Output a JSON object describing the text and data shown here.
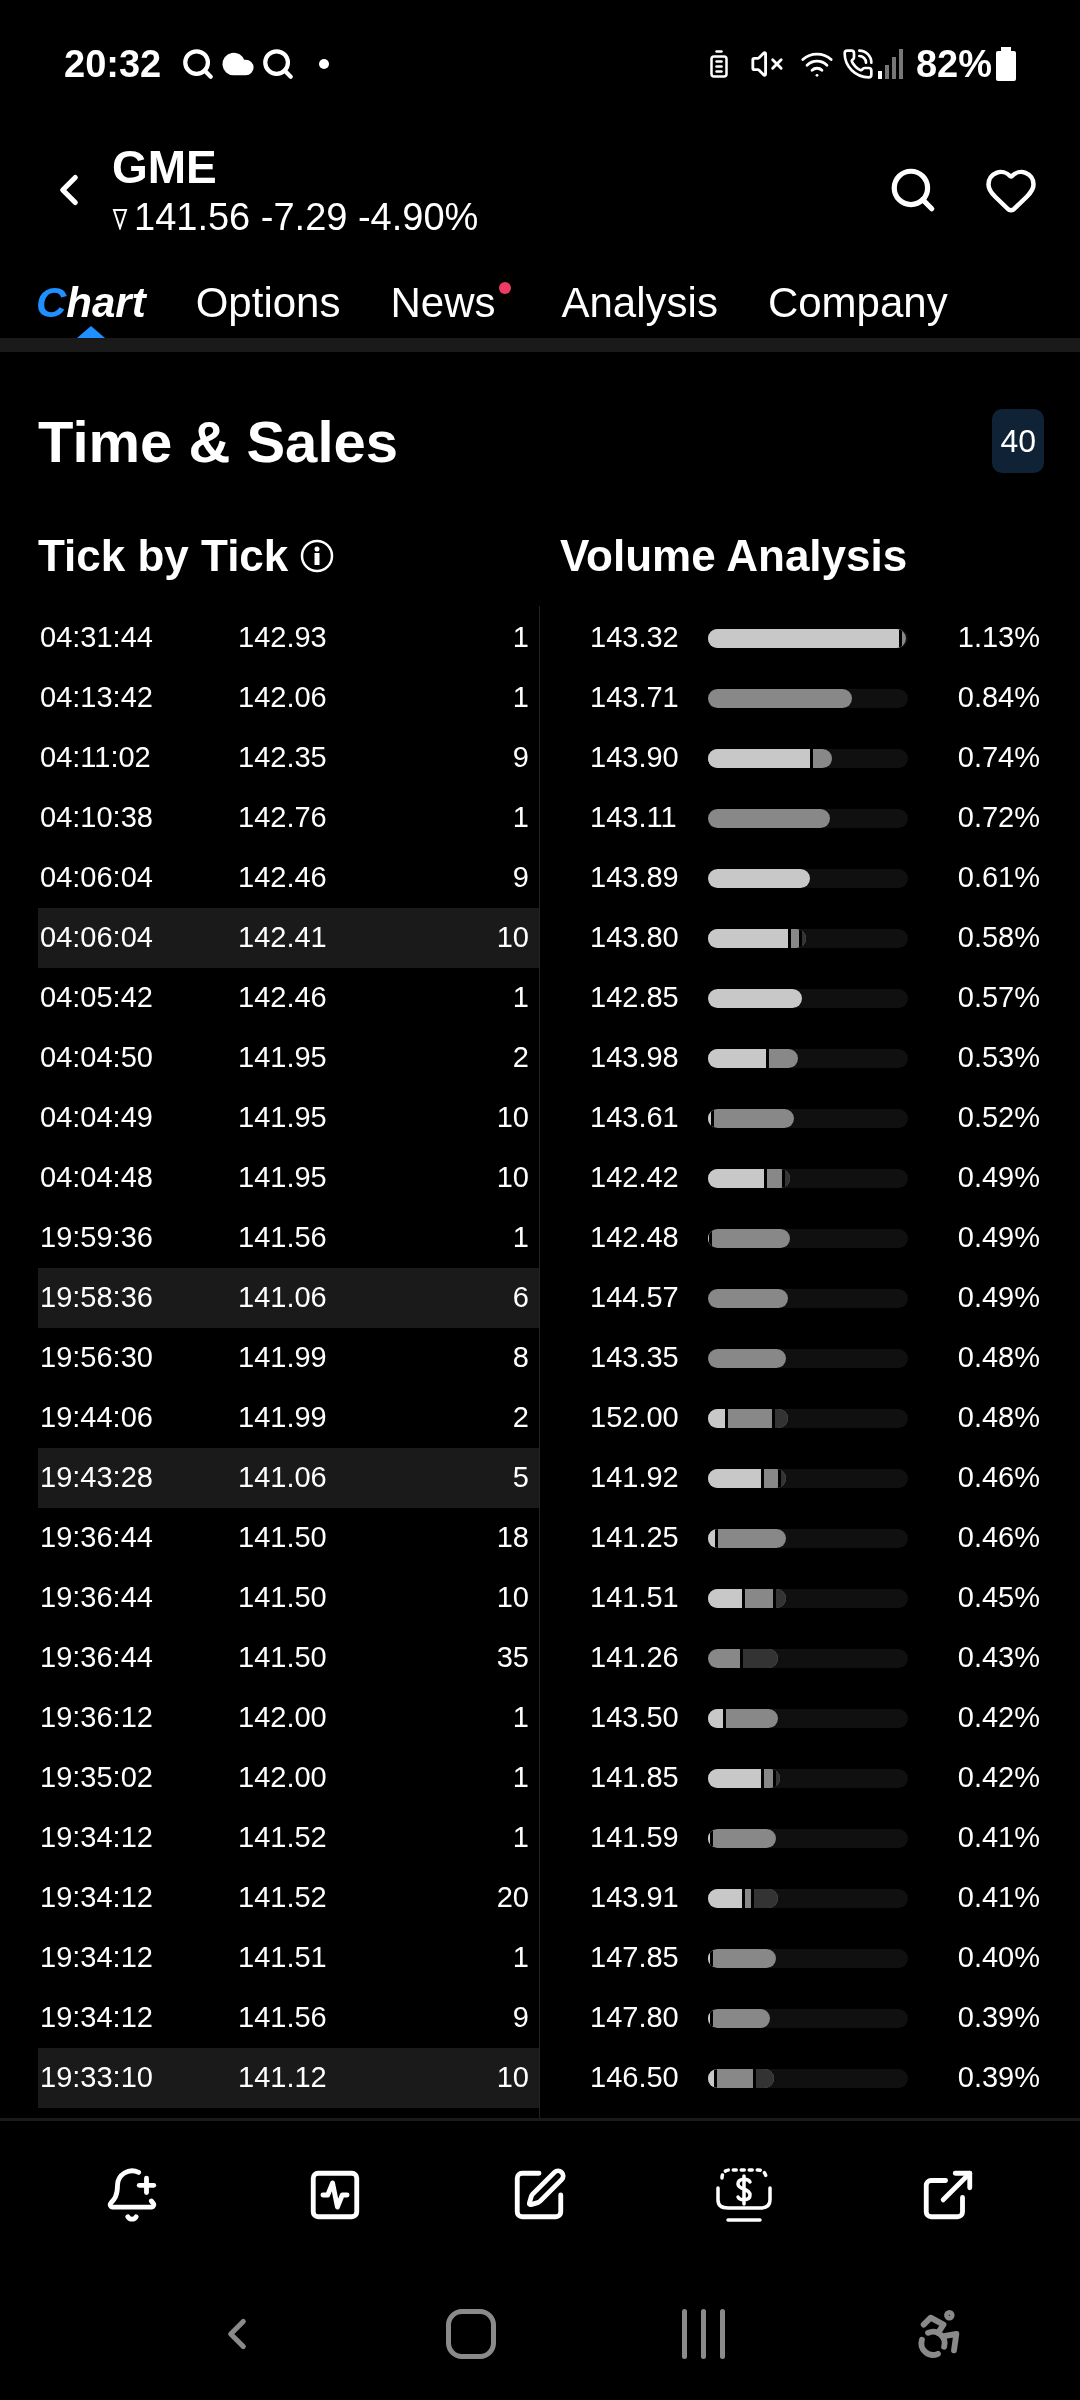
{
  "status_bar": {
    "time": "20:32",
    "battery": "82%"
  },
  "header": {
    "symbol": "GME",
    "quote": "141.56 -7.29 -4.90%",
    "favorite": false
  },
  "tabs": [
    {
      "label": "Chart",
      "selected": true,
      "badge": false
    },
    {
      "label": "Options",
      "selected": false,
      "badge": false
    },
    {
      "label": "News",
      "selected": false,
      "badge": true
    },
    {
      "label": "Analysis",
      "selected": false,
      "badge": false
    },
    {
      "label": "Company",
      "selected": false,
      "badge": false
    }
  ],
  "section": {
    "title": "Time & Sales",
    "count": "40"
  },
  "tick_by_tick": {
    "title": "Tick by Tick",
    "rows": [
      {
        "time": "04:31:44",
        "price": "142.93",
        "size": "1",
        "highlighted": false
      },
      {
        "time": "04:13:42",
        "price": "142.06",
        "size": "1",
        "highlighted": false
      },
      {
        "time": "04:11:02",
        "price": "142.35",
        "size": "9",
        "highlighted": false
      },
      {
        "time": "04:10:38",
        "price": "142.76",
        "size": "1",
        "highlighted": false
      },
      {
        "time": "04:06:04",
        "price": "142.46",
        "size": "9",
        "highlighted": false
      },
      {
        "time": "04:06:04",
        "price": "142.41",
        "size": "10",
        "highlighted": true
      },
      {
        "time": "04:05:42",
        "price": "142.46",
        "size": "1",
        "highlighted": false
      },
      {
        "time": "04:04:50",
        "price": "141.95",
        "size": "2",
        "highlighted": false
      },
      {
        "time": "04:04:49",
        "price": "141.95",
        "size": "10",
        "highlighted": false
      },
      {
        "time": "04:04:48",
        "price": "141.95",
        "size": "10",
        "highlighted": false
      },
      {
        "time": "19:59:36",
        "price": "141.56",
        "size": "1",
        "highlighted": false
      },
      {
        "time": "19:58:36",
        "price": "141.06",
        "size": "6",
        "highlighted": true
      },
      {
        "time": "19:56:30",
        "price": "141.99",
        "size": "8",
        "highlighted": false
      },
      {
        "time": "19:44:06",
        "price": "141.99",
        "size": "2",
        "highlighted": false
      },
      {
        "time": "19:43:28",
        "price": "141.06",
        "size": "5",
        "highlighted": true
      },
      {
        "time": "19:36:44",
        "price": "141.50",
        "size": "18",
        "highlighted": false
      },
      {
        "time": "19:36:44",
        "price": "141.50",
        "size": "10",
        "highlighted": false
      },
      {
        "time": "19:36:44",
        "price": "141.50",
        "size": "35",
        "highlighted": false
      },
      {
        "time": "19:36:12",
        "price": "142.00",
        "size": "1",
        "highlighted": false
      },
      {
        "time": "19:35:02",
        "price": "142.00",
        "size": "1",
        "highlighted": false
      },
      {
        "time": "19:34:12",
        "price": "141.52",
        "size": "1",
        "highlighted": false
      },
      {
        "time": "19:34:12",
        "price": "141.52",
        "size": "20",
        "highlighted": false
      },
      {
        "time": "19:34:12",
        "price": "141.51",
        "size": "1",
        "highlighted": false
      },
      {
        "time": "19:34:12",
        "price": "141.56",
        "size": "9",
        "highlighted": false
      },
      {
        "time": "19:33:10",
        "price": "141.12",
        "size": "10",
        "highlighted": true
      }
    ]
  },
  "volume_analysis": {
    "title": "Volume Analysis",
    "rows": [
      {
        "price": "143.32",
        "share": "1.13%",
        "kind": "mixed",
        "level": 0.99,
        "buy": {
          "level": 0.98
        }
      },
      {
        "price": "143.71",
        "share": "0.84%",
        "kind": "mixed",
        "level": 0.72
      },
      {
        "price": "143.90",
        "share": "0.74%",
        "kind": "mixed",
        "level": 0.62,
        "buy": {
          "level": 0.85
        }
      },
      {
        "price": "143.11",
        "share": "0.72%",
        "kind": "mixed",
        "level": 0.61
      },
      {
        "price": "143.89",
        "share": "0.61%",
        "kind": "buy",
        "level": 0.51
      },
      {
        "price": "143.80",
        "share": "0.58%",
        "kind": "mixed",
        "level": 0.49,
        "buy": {
          "level": 0.85
        },
        "sell": {
          "level": 0.07
        }
      },
      {
        "price": "142.85",
        "share": "0.57%",
        "kind": "buy",
        "level": 0.47
      },
      {
        "price": "143.98",
        "share": "0.53%",
        "kind": "mixed",
        "level": 0.45,
        "buy": {
          "level": 0.68
        }
      },
      {
        "price": "143.61",
        "share": "0.52%",
        "kind": "mixed",
        "level": 0.43,
        "buy": {
          "level": 0.07
        }
      },
      {
        "price": "142.42",
        "share": "0.49%",
        "kind": "mixed",
        "level": 0.41,
        "buy": {
          "level": 0.72
        },
        "sell": {
          "level": 0.1
        }
      },
      {
        "price": "142.48",
        "share": "0.49%",
        "kind": "mixed",
        "level": 0.41,
        "buy": {
          "level": 0.05
        }
      },
      {
        "price": "144.57",
        "share": "0.49%",
        "kind": "mixed",
        "level": 0.4
      },
      {
        "price": "143.35",
        "share": "0.48%",
        "kind": "mixed",
        "level": 0.39
      },
      {
        "price": "152.00",
        "share": "0.48%",
        "kind": "mixed",
        "level": 0.4,
        "buy": {
          "level": 0.25
        },
        "sell": {
          "level": 0.2
        }
      },
      {
        "price": "141.92",
        "share": "0.46%",
        "kind": "mixed",
        "level": 0.39,
        "buy": {
          "level": 0.72
        },
        "sell": {
          "level": 0.1
        }
      },
      {
        "price": "141.25",
        "share": "0.46%",
        "kind": "mixed",
        "level": 0.39,
        "buy": {
          "level": 0.13
        }
      },
      {
        "price": "141.51",
        "share": "0.45%",
        "kind": "mixed",
        "level": 0.39,
        "buy": {
          "level": 0.47
        },
        "sell": {
          "level": 0.17
        }
      },
      {
        "price": "141.26",
        "share": "0.43%",
        "kind": "mixed",
        "level": 0.35,
        "sell": {
          "level": 0.55
        }
      },
      {
        "price": "143.50",
        "share": "0.42%",
        "kind": "mixed",
        "level": 0.35,
        "buy": {
          "level": 0.25
        }
      },
      {
        "price": "141.85",
        "share": "0.42%",
        "kind": "mixed",
        "level": 0.36,
        "buy": {
          "level": 0.78
        },
        "sell": {
          "level": 0.1
        }
      },
      {
        "price": "141.59",
        "share": "0.41%",
        "kind": "mixed",
        "level": 0.34,
        "buy": {
          "level": 0.08
        }
      },
      {
        "price": "143.91",
        "share": "0.41%",
        "kind": "mixed",
        "level": 0.35,
        "buy": {
          "level": 0.53
        },
        "sell": {
          "level": 0.38
        }
      },
      {
        "price": "147.85",
        "share": "0.40%",
        "kind": "mixed",
        "level": 0.34,
        "buy": {
          "level": 0.08
        }
      },
      {
        "price": "147.80",
        "share": "0.39%",
        "kind": "mixed",
        "level": 0.31,
        "buy": {
          "level": 0.08
        }
      },
      {
        "price": "146.50",
        "share": "0.39%",
        "kind": "mixed",
        "level": 0.33,
        "buy": {
          "level": 0.13
        },
        "sell": {
          "level": 0.32
        }
      }
    ]
  }
}
